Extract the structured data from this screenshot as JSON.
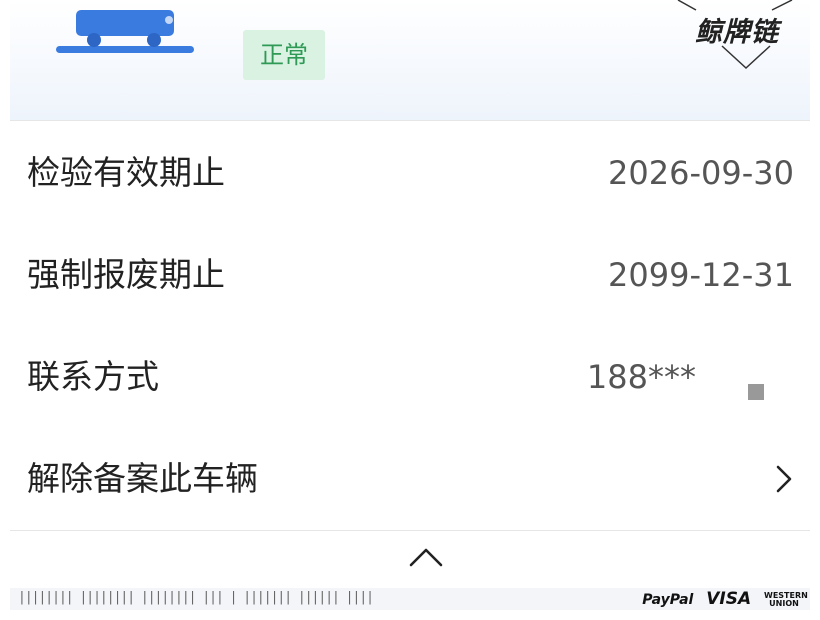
{
  "header": {
    "status": "正常",
    "watermark": "鲸牌链"
  },
  "rows": [
    {
      "label": "检验有效期止",
      "value": "2026-09-30"
    },
    {
      "label": "强制报废期止",
      "value": "2099-12-31"
    },
    {
      "label": "联系方式",
      "value": "188***"
    },
    {
      "label": "解除备案此车辆"
    }
  ],
  "footer": {
    "barcode": "|||||||| |||||||| |||||||| ||| | |||||||  |||||| ||||",
    "payments": {
      "paypal": "PayPal",
      "visa": "VISA",
      "western_union": "WESTERN UNION"
    }
  },
  "icons": [
    "car-icon",
    "copy-icon",
    "chevron-right-icon",
    "chevron-up-icon"
  ],
  "colors": {
    "status_bg": "#d9f2e2",
    "status_text": "#2f9a55",
    "car_blue": "#3a7be0"
  }
}
